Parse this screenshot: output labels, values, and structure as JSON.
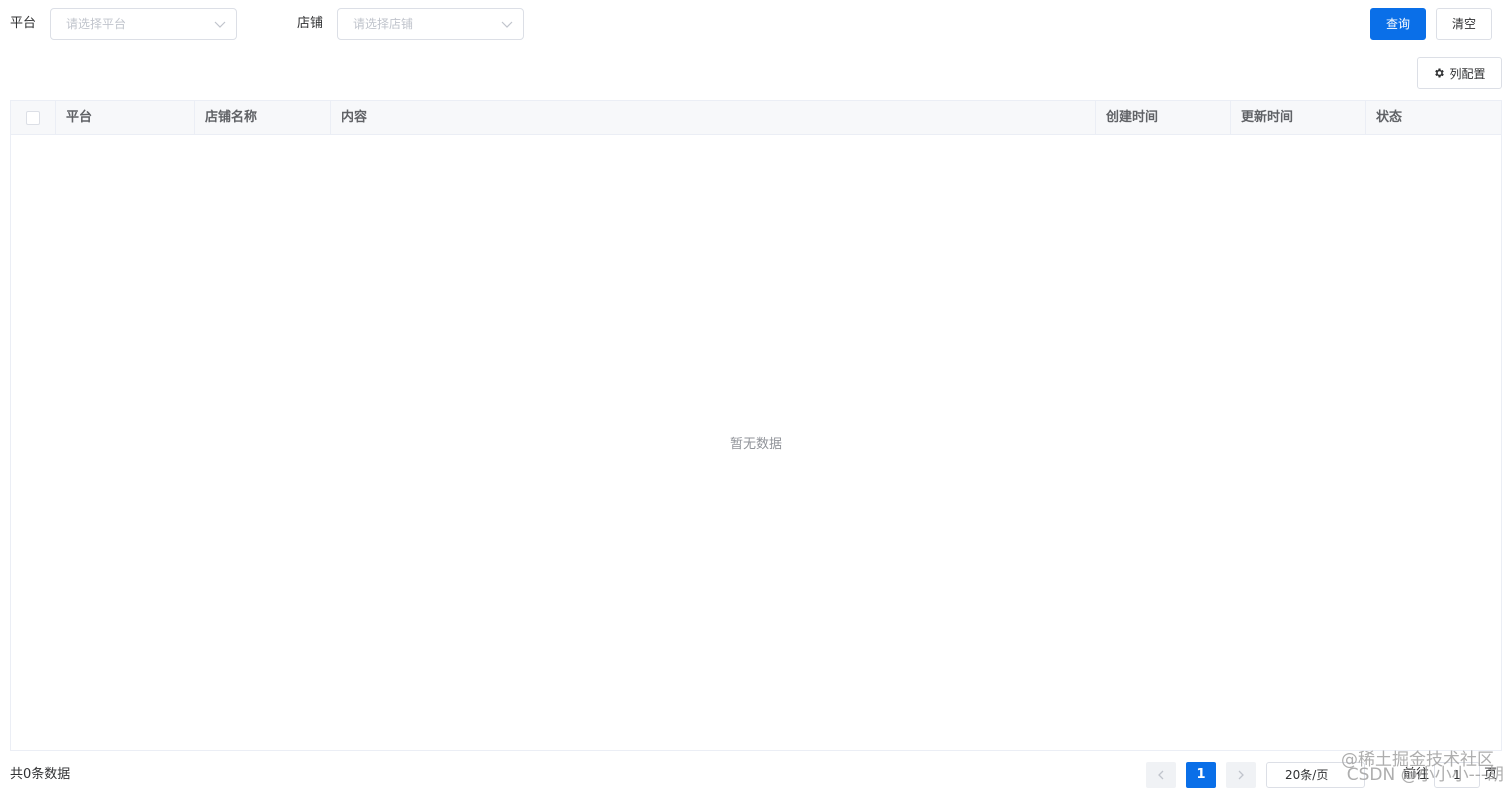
{
  "filters": {
    "platform": {
      "label": "平台",
      "placeholder": "请选择平台"
    },
    "store": {
      "label": "店铺",
      "placeholder": "请选择店铺"
    }
  },
  "actions": {
    "query_label": "查询",
    "clear_label": "清空",
    "column_config_label": "列配置",
    "column_config_icon": "gear-icon"
  },
  "colors": {
    "primary": "#0a6fe8",
    "border": "#dcdfe6",
    "header_bg": "#f7f8fa"
  },
  "table": {
    "columns": [
      "平台",
      "店铺名称",
      "内容",
      "创建时间",
      "更新时间",
      "状态"
    ],
    "rows": [],
    "empty_text": "暂无数据"
  },
  "footer": {
    "total_text": "共0条数据",
    "current_page": "1",
    "page_size": "20条/页",
    "goto_label": "前往",
    "goto_value": "1",
    "goto_suffix": "页"
  },
  "watermarks": [
    "@稀土掘金技术社区",
    "CSDN @小小小---胡"
  ]
}
